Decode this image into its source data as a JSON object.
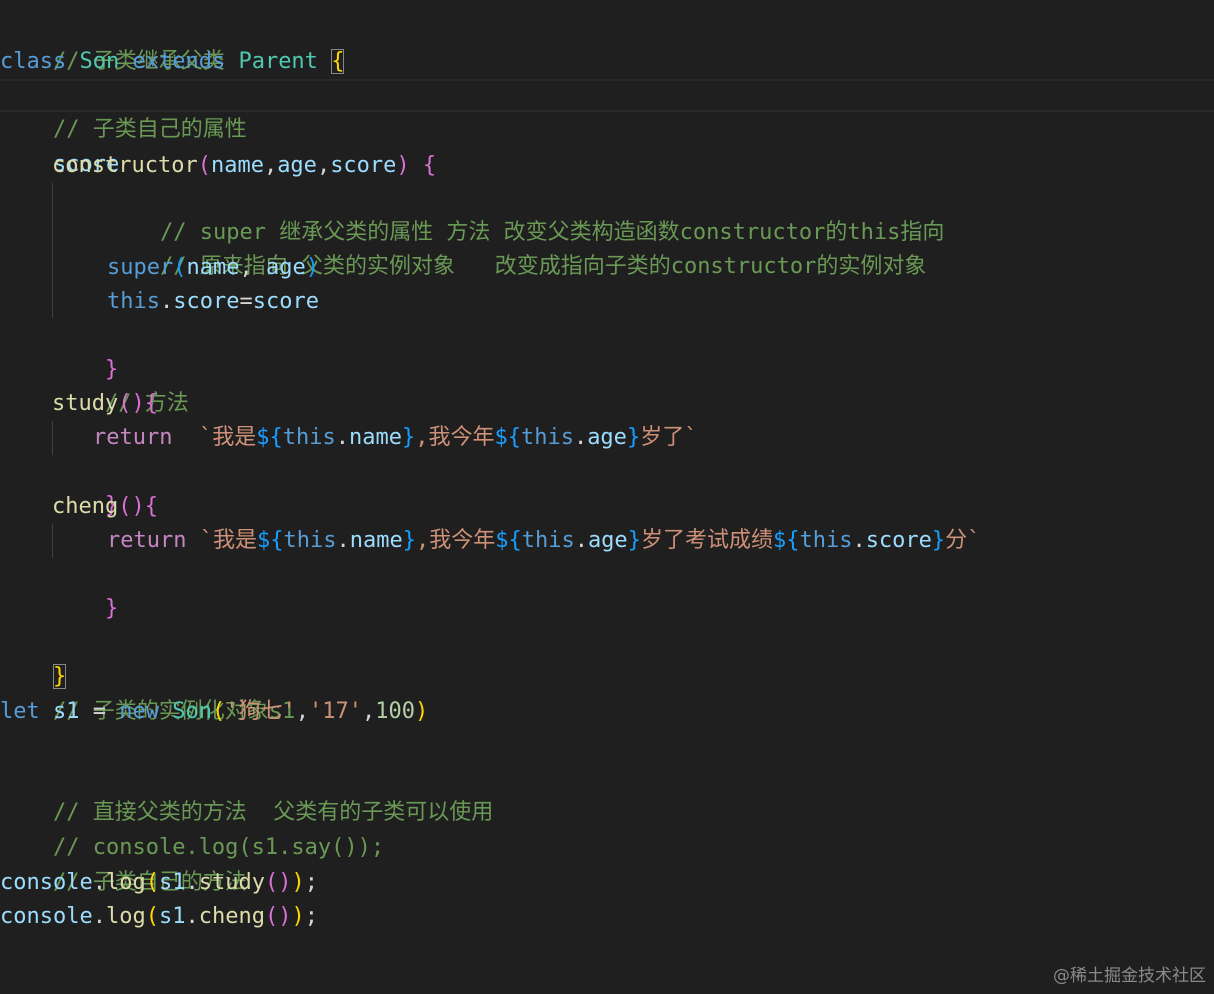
{
  "colors": {
    "background": "#1f1f1f",
    "keyword": "#569cd6",
    "control": "#c586c0",
    "class_name": "#4ec9b0",
    "function": "#dcdcaa",
    "variable": "#9cdcfe",
    "string": "#ce9178",
    "number": "#b5cea8",
    "comment": "#6a9955",
    "bracket_level1": "#ffd700",
    "bracket_level2": "#da70d6",
    "bracket_level3": "#179fff"
  },
  "watermark": "@稀土掘金技术社区",
  "code": {
    "l01": {
      "c": "// 子类继承父类"
    },
    "l02": {
      "kw": "class",
      "s1": " ",
      "cls": "Son",
      "s2": " ",
      "kw2": "extends",
      "s3": " ",
      "par": "Parent",
      "s4": " ",
      "br": "{"
    },
    "l03": {
      "c": "// 子类自己的属性"
    },
    "l04": {
      "v": "score"
    },
    "l05": {
      "fn": "constructor",
      "o": "(",
      "a1": "name",
      "c1": ",",
      "a2": "age",
      "c2": ",",
      "a3": "score",
      "cl": ")",
      "s": " ",
      "br": "{"
    },
    "l06": {
      "c": "// super 继承父类的属性 方法 改变父类构造函数constructor的this指向"
    },
    "l07": {
      "c": "// 原来指向 父类的实例对象   改变成指向子类的constructor的实例对象"
    },
    "l08": {
      "kw": "super",
      "o": "(",
      "a1": "name",
      "c1": ", ",
      "a2": "age",
      "cl": ")"
    },
    "l09": {
      "kw": "this",
      "d": ".",
      "p": "score",
      "eq": "=",
      "v": "score"
    },
    "l10": {
      "br": "}"
    },
    "l11": {
      "c": "// 方法"
    },
    "l12": {
      "fn": "study",
      "o": "(",
      "cl": ")",
      "br": "{"
    },
    "l13": {
      "kw": "return",
      "s": "  ",
      "t1": "`我是",
      "i1o": "${",
      "i1k": "this",
      "i1d": ".",
      "i1p": "name",
      "i1c": "}",
      "t2": ",我今年",
      "i2o": "${",
      "i2k": "this",
      "i2d": ".",
      "i2p": "age",
      "i2c": "}",
      "t3": "岁了`"
    },
    "l14": {
      "br": "}"
    },
    "l15": {
      "fn": "cheng",
      "o": "(",
      "cl": ")",
      "br": "{"
    },
    "l16": {
      "kw": "return",
      "s": " ",
      "t1": "`我是",
      "i1o": "${",
      "i1k": "this",
      "i1d": ".",
      "i1p": "name",
      "i1c": "}",
      "t2": ",我今年",
      "i2o": "${",
      "i2k": "this",
      "i2d": ".",
      "i2p": "age",
      "i2c": "}",
      "t3": "岁了考试成绩",
      "i3o": "${",
      "i3k": "this",
      "i3d": ".",
      "i3p": "score",
      "i3c": "}",
      "t4": "分`"
    },
    "l17": {
      "br": "}"
    },
    "l18": {
      "br": "}"
    },
    "l19": {
      "c": "// 子类的实例化对象s1"
    },
    "l20": {
      "kw": "let",
      "s1": " ",
      "v": "s1",
      "eq": " = ",
      "kw2": "new",
      "s2": " ",
      "cls": "Son",
      "o": "(",
      "a1": "'狗七'",
      "c1": ",",
      "a2": "'17'",
      "c2": ",",
      "n": "100",
      "cl": ")"
    },
    "l21": {
      "c": "// 直接父类的方法  父类有的子类可以使用"
    },
    "l22": {
      "c": "// console.log(s1.say());"
    },
    "l23": {
      "c": "// 子类自己的方法"
    },
    "l24": {
      "v": "console",
      "d": ".",
      "fn": "log",
      "o": "(",
      "v2": "s1",
      "d2": ".",
      "fn2": "study",
      "o2": "()",
      "cl": ")",
      "sc": ";"
    },
    "l25": {
      "v": "console",
      "d": ".",
      "fn": "log",
      "o": "(",
      "v2": "s1",
      "d2": ".",
      "fn2": "cheng",
      "o2": "()",
      "cl": ")",
      "sc": ";"
    }
  }
}
